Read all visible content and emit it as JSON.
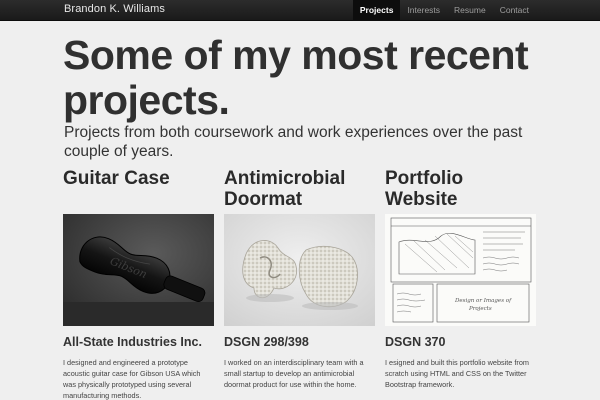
{
  "header": {
    "brand": "Brandon K. Williams",
    "nav": [
      {
        "label": "Projects",
        "active": true
      },
      {
        "label": "Interests",
        "active": false
      },
      {
        "label": "Resume",
        "active": false
      },
      {
        "label": "Contact",
        "active": false
      }
    ]
  },
  "hero": {
    "title": "Some of my most recent projects.",
    "subtitle": "Projects from both coursework and work experiences over the past couple of years."
  },
  "projects": [
    {
      "title": "Guitar Case",
      "image_icon": "guitar-case-photo",
      "org": "All-State Industries Inc.",
      "description": "I designed and engineered a prototype acoustic guitar case for Gibson USA which was physically prototyped using several manufacturing methods."
    },
    {
      "title": "Antimicrobial Doormat",
      "image_icon": "doormat-samples-photo",
      "org": "DSGN 298/398",
      "description": "I worked on an interdisciplinary team with a small startup to develop an antimicrobial doormat product for use within the home."
    },
    {
      "title": "Portfolio Website",
      "image_icon": "wireframe-sketch",
      "org": "DSGN 370",
      "description": "I esigned and built this portfolio website from scratch using HTML and CSS on the Twitter Bootstrap framework."
    }
  ],
  "colors": {
    "navbar": "#1f1f1f",
    "page_bg": "#efefef",
    "heading": "#303030"
  }
}
